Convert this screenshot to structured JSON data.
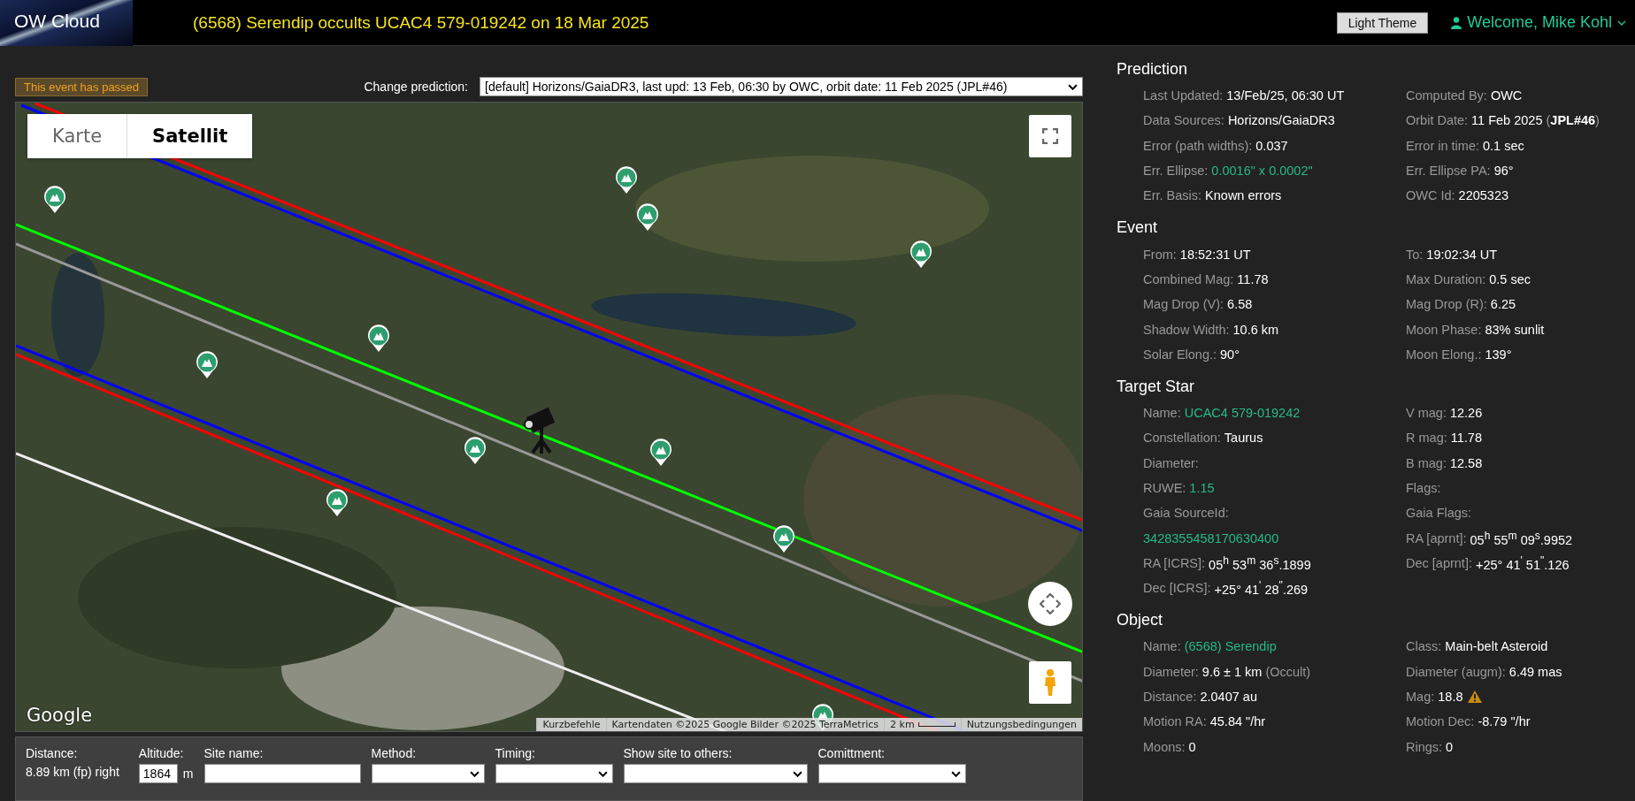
{
  "header": {
    "logo": "OW Cloud",
    "title": "(6568) Serendip occults UCAC4 579-019242 on 18 Mar 2025",
    "theme_button": "Light Theme",
    "welcome": "Welcome, Mike Kohl"
  },
  "status_badge": "This event has passed",
  "prediction_select": {
    "label": "Change prediction:",
    "value": "[default] Horizons/GaiaDR3, last upd: 13 Feb, 06:30 by OWC, orbit date: 11 Feb 2025 (JPL#46)"
  },
  "map": {
    "map_types": [
      {
        "label": "Karte",
        "selected": false
      },
      {
        "label": "Satellit",
        "selected": true
      }
    ],
    "logo": "Google",
    "attribution": [
      {
        "kind": "link",
        "text": "Kurzbefehle"
      },
      {
        "kind": "link",
        "text": "Kartendaten ©2025 Google Bilder ©2025 TerraMetrics"
      },
      {
        "kind": "scale",
        "text": "2 km"
      },
      {
        "kind": "link",
        "text": "Nutzungsbedingungen"
      }
    ]
  },
  "site_form": {
    "distance": {
      "label": "Distance:",
      "value": "8.89 km (fp) right"
    },
    "altitude": {
      "label": "Altitude:",
      "value": "1864",
      "unit": "m"
    },
    "site_name": {
      "label": "Site name:"
    },
    "dropdowns": [
      {
        "label": "Method:"
      },
      {
        "label": "Timing:"
      },
      {
        "label": "Show site to others:"
      },
      {
        "label": "Comittment:"
      }
    ]
  },
  "sections": [
    {
      "title": "Prediction",
      "items": [
        {
          "label": "Last Updated:",
          "value": "13/Feb/25, 06:30 UT"
        },
        {
          "label": "Computed By:",
          "value": "OWC"
        },
        {
          "label": "Data Sources:",
          "value": "Horizons/GaiaDR3"
        },
        {
          "label": "Orbit Date:",
          "value": "11 Feb 2025",
          "note": "(**JPL#46**)"
        },
        {
          "label": "Error (path widths):",
          "value": "0.037"
        },
        {
          "label": "Error in time:",
          "value": "0.1 sec"
        },
        {
          "label": "Err. Ellipse:",
          "value": "0.0016\" x 0.0002\"",
          "highlight": true
        },
        {
          "label": "Err. Ellipse PA:",
          "value": "96°"
        },
        {
          "label": "Err. Basis:",
          "value": "Known errors"
        },
        {
          "label": "OWC Id:",
          "value": "2205323"
        }
      ]
    },
    {
      "title": "Event",
      "items": [
        {
          "label": "From:",
          "value": "18:52:31 UT"
        },
        {
          "label": "To:",
          "value": "19:02:34 UT"
        },
        {
          "label": "Combined Mag:",
          "value": "11.78"
        },
        {
          "label": "Max Duration:",
          "value": "0.5 sec"
        },
        {
          "label": "Mag Drop (V):",
          "value": "6.58"
        },
        {
          "label": "Mag Drop (R):",
          "value": "6.25"
        },
        {
          "label": "Shadow Width:",
          "value": "10.6 km"
        },
        {
          "label": "Moon Phase:",
          "value": "83% sunlit"
        },
        {
          "label": "Solar Elong.:",
          "value": "90°"
        },
        {
          "label": "Moon Elong.:",
          "value": "139°"
        }
      ]
    },
    {
      "title": "Target Star",
      "items": [
        {
          "label": "Name:",
          "value": "UCAC4 579-019242",
          "highlight": true
        },
        {
          "label": "V mag:",
          "value": "12.26"
        },
        {
          "label": "Constellation:",
          "value": "Taurus"
        },
        {
          "label": "R mag:",
          "value": "11.78"
        },
        {
          "label": "Diameter:"
        },
        {
          "label": "B mag:",
          "value": "12.58"
        },
        {
          "label": "RUWE:",
          "value": "1.15",
          "highlight": true
        },
        {
          "label": "Flags:"
        },
        {
          "label": "Gaia SourceId:"
        },
        {
          "label": "Gaia Flags:"
        },
        {
          "value": "3428355458170630400",
          "highlight": true
        },
        {
          "label": "RA [aprnt]:",
          "value": "05$^{h}$ 55$^{m}$ 09$^{s}$.9952"
        },
        {
          "label": "RA [ICRS]:",
          "value": "05$^{h}$ 53$^{m}$ 36$^{s}$.1899"
        },
        {
          "label": "Dec [aprnt]:",
          "value": "+25° 41$^{'}$ 51$^{\"}$.126"
        },
        {
          "label": "Dec [ICRS]:",
          "value": "+25° 41$^{'}$ 28$^{\"}$.269"
        }
      ]
    },
    {
      "title": "Object",
      "items": [
        {
          "label": "Name:",
          "value": "(6568) Serendip",
          "highlight": true
        },
        {
          "label": "Class:",
          "value": "Main-belt Asteroid"
        },
        {
          "label": "Diameter:",
          "value": "9.6 ± 1 km",
          "note": "(Occult)"
        },
        {
          "label": "Diameter (augm):",
          "value": "6.49 mas"
        },
        {
          "label": "Distance:",
          "value": "2.0407 au"
        },
        {
          "label": "Mag:",
          "value": "18.8",
          "warning": true
        },
        {
          "label": "Motion RA:",
          "value": "45.84 \"/hr"
        },
        {
          "label": "Motion Dec:",
          "value": "-8.79 \"/hr"
        },
        {
          "label": "Moons:",
          "value": "0"
        },
        {
          "label": "Rings:",
          "value": "0"
        }
      ]
    }
  ]
}
